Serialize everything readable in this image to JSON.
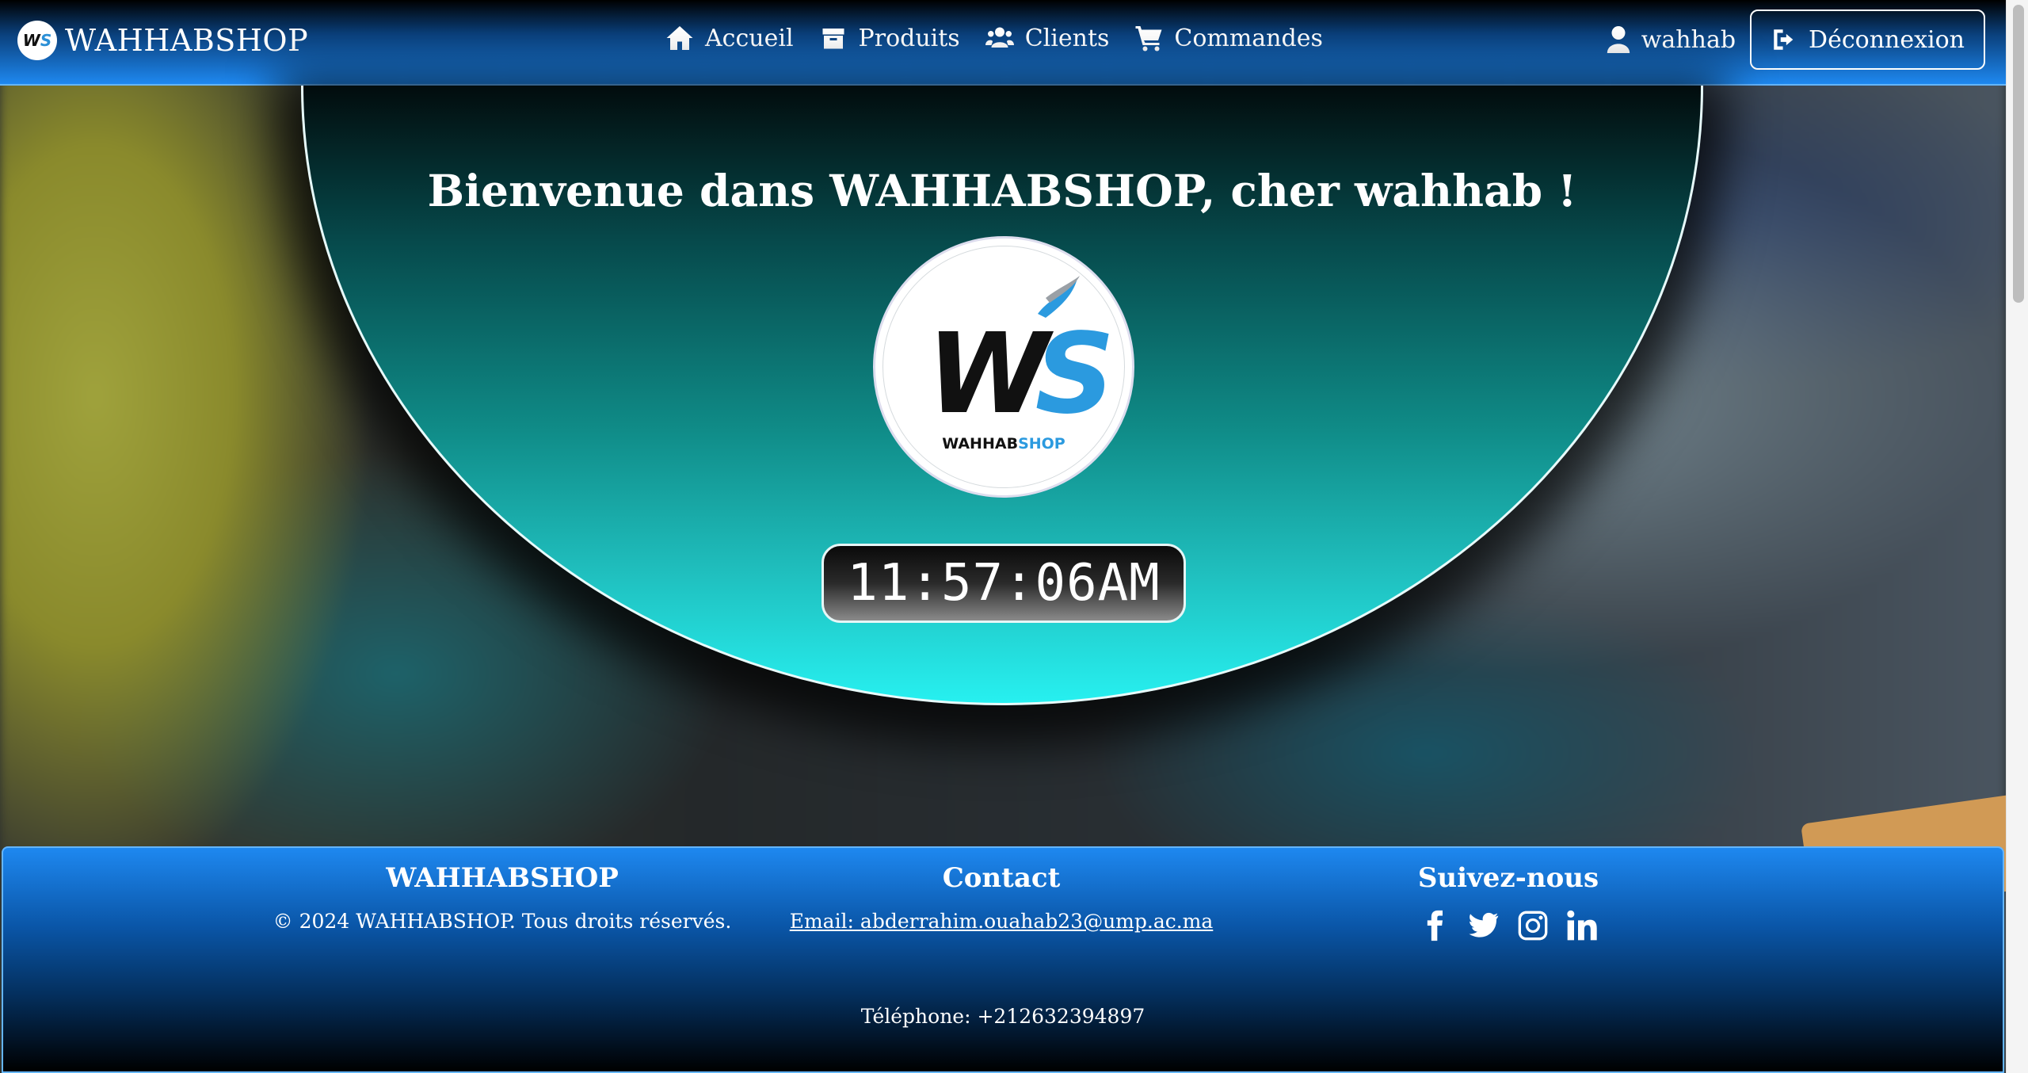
{
  "navbar": {
    "brand": "WAHHABSHOP",
    "links": [
      {
        "label": "Accueil",
        "icon": "home-icon"
      },
      {
        "label": "Produits",
        "icon": "box-icon"
      },
      {
        "label": "Clients",
        "icon": "users-icon"
      },
      {
        "label": "Commandes",
        "icon": "cart-icon"
      }
    ],
    "username": "wahhab",
    "logout_label": "Déconnexion"
  },
  "hero": {
    "welcome": "Bienvenue dans WAHHABSHOP, cher wahhab !",
    "logo_text_a": "WAHHAB",
    "logo_text_b": "SHOP",
    "clock": "11:57:06AM"
  },
  "footer": {
    "col1_title": "WAHHABSHOP",
    "col1_text": "© 2024 WAHHABSHOP. Tous droits réservés.",
    "col2_title": "Contact",
    "email": "Email: abderrahim.ouahab23@ump.ac.ma",
    "phone": "Téléphone: +212632394897",
    "col3_title": "Suivez-nous",
    "social": [
      "facebook-icon",
      "twitter-icon",
      "instagram-icon",
      "linkedin-icon"
    ]
  },
  "colors": {
    "nav_accent": "#1e88f0",
    "hero_top": "#020c0d",
    "hero_bottom": "#27f0f0",
    "logo_blue": "#2b9adf"
  }
}
